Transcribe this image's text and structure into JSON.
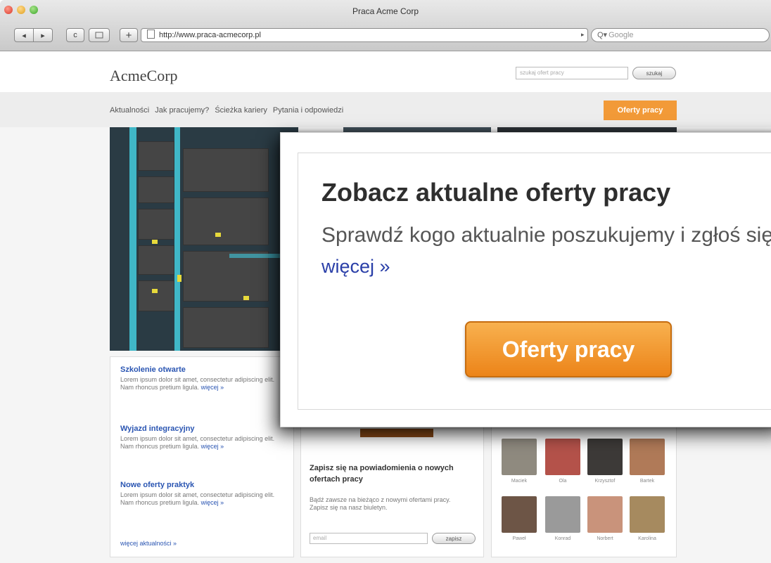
{
  "browser": {
    "window_title": "Praca Acme Corp",
    "url": "http://www.praca-acmecorp.pl",
    "search_placeholder": "Google",
    "back_icon": "◂",
    "forward_icon": "▸",
    "reload_icon": "c"
  },
  "site": {
    "logo": "AcmeCorp",
    "search_placeholder": "szukaj ofert pracy",
    "search_button": "szukaj",
    "nav": [
      "Aktualności",
      "Jak pracujemy?",
      "Ścieżka kariery",
      "Pytania i odpowiedzi"
    ],
    "nav_cta": "Oferty pracy"
  },
  "news": {
    "items": [
      {
        "title": "Szkolenie otwarte",
        "body": "Lorem ipsum dolor sit amet, consectetur adipiscing elit. Nam rhoncus pretium ligula.",
        "more": "więcej »"
      },
      {
        "title": "Wyjazd integracyjny",
        "body": "Lorem ipsum dolor sit amet, consectetur adipiscing elit. Nam rhoncus pretium ligula.",
        "more": "więcej »"
      },
      {
        "title": "Nowe oferty praktyk",
        "body": "Lorem ipsum dolor sit amet, consectetur adipiscing elit. Nam rhoncus pretium ligula.",
        "more": "więcej »"
      }
    ],
    "all_link": "więcej aktualności »"
  },
  "subscribe": {
    "title": "Zapisz się na powiadomienia o nowych ofertach pracy",
    "body": "Bądź zawsze na bieżąco z nowymi ofertami pracy. Zapisz się na nasz biuletyn.",
    "email_placeholder": "email",
    "button": "zapisz"
  },
  "team": {
    "people": [
      {
        "name": "Maciek",
        "color": "#8f8a7f"
      },
      {
        "name": "Ola",
        "color": "#b4524a"
      },
      {
        "name": "Krzysztof",
        "color": "#3d3a38"
      },
      {
        "name": "Bartek",
        "color": "#b07a58"
      },
      {
        "name": "Paweł",
        "color": "#6d5546"
      },
      {
        "name": "Konrad",
        "color": "#9a9a9a"
      },
      {
        "name": "Norbert",
        "color": "#c9937b"
      },
      {
        "name": "Karolina",
        "color": "#a68a5f"
      }
    ]
  },
  "modal": {
    "heading": "Zobacz aktualne oferty pracy",
    "text": "Sprawdź kogo aktualnie poszukujemy i zgłoś się!",
    "more_link": "więcej »",
    "cta": "Oferty pracy"
  },
  "colors": {
    "accent_orange": "#f29a38",
    "link_blue": "#2a55b2"
  }
}
